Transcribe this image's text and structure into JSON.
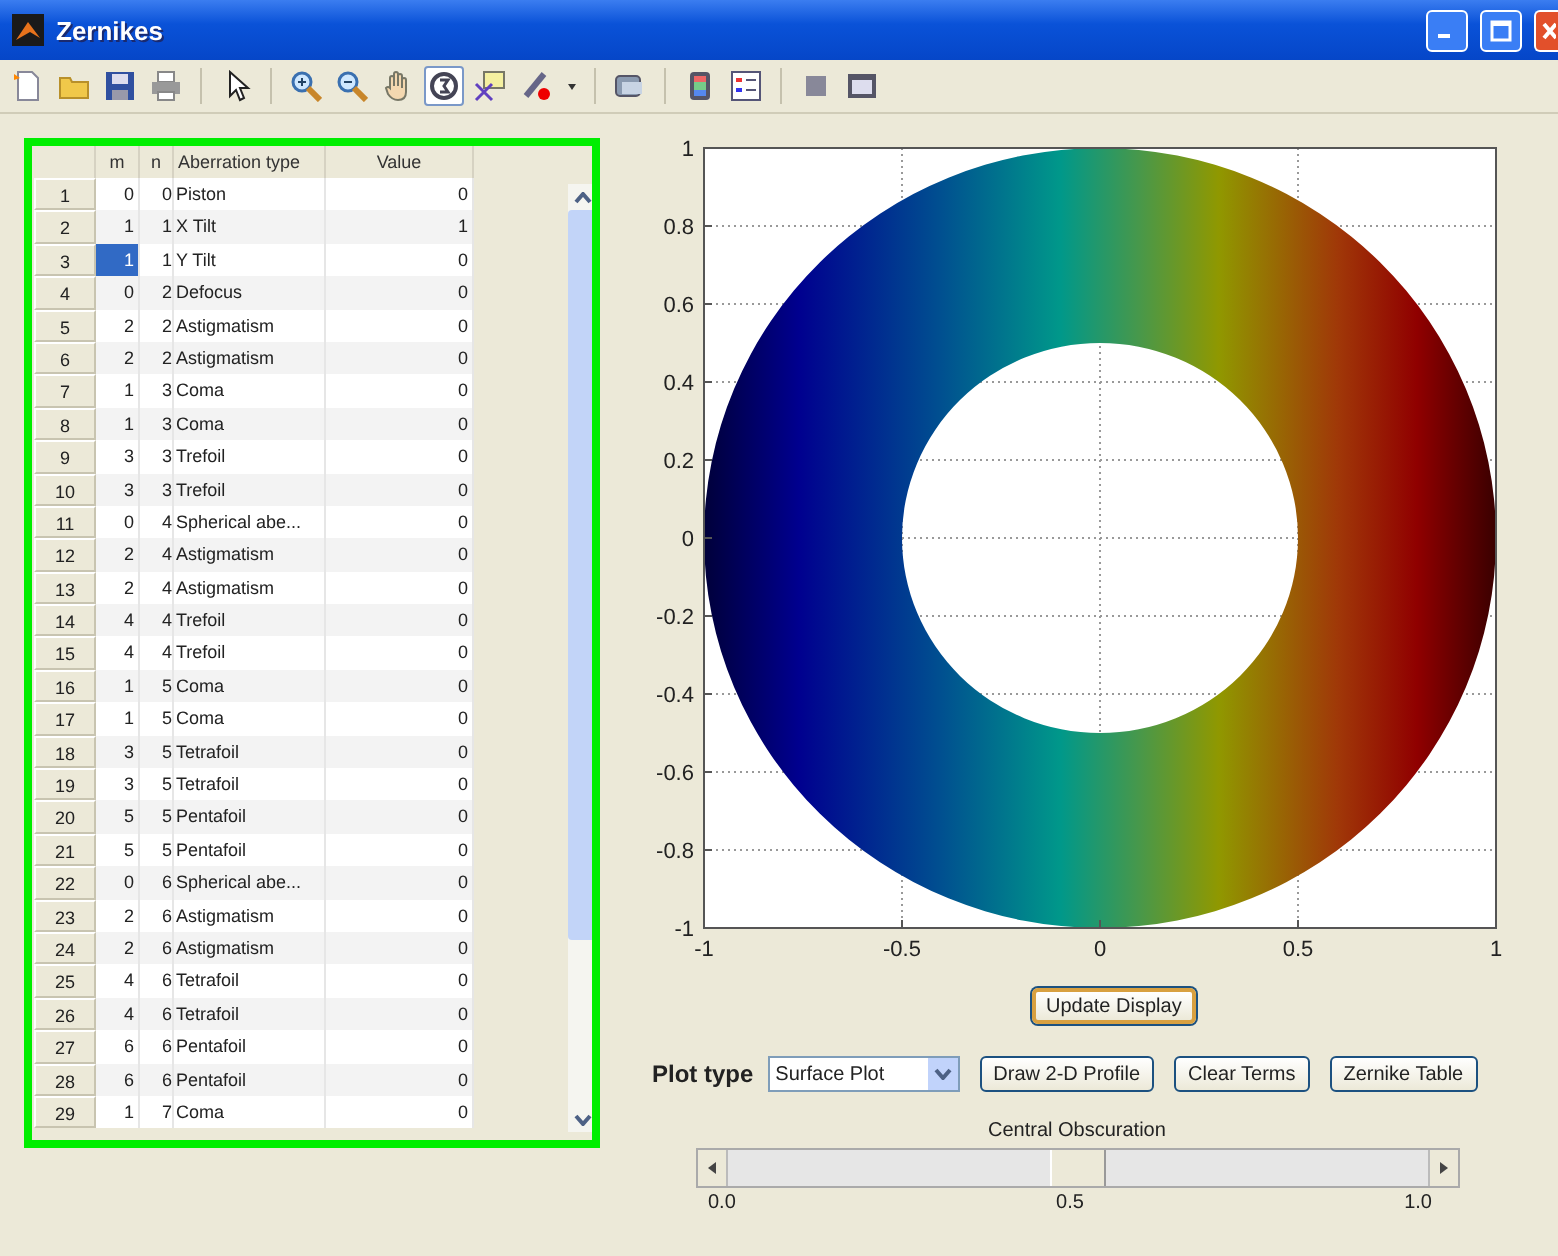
{
  "window": {
    "title": "Zernikes"
  },
  "toolbar": [
    {
      "kind": "new",
      "pressed": false
    },
    {
      "kind": "open",
      "pressed": false
    },
    {
      "kind": "save",
      "pressed": false
    },
    {
      "kind": "print",
      "pressed": false
    },
    {
      "kind": "sep"
    },
    {
      "kind": "pointer",
      "pressed": false
    },
    {
      "kind": "sep"
    },
    {
      "kind": "zoomin",
      "pressed": false
    },
    {
      "kind": "zoomout",
      "pressed": false
    },
    {
      "kind": "pan",
      "pressed": false
    },
    {
      "kind": "rotate",
      "pressed": true
    },
    {
      "kind": "cursor",
      "pressed": false
    },
    {
      "kind": "brush",
      "pressed": false
    },
    {
      "kind": "dropdown",
      "pressed": false
    },
    {
      "kind": "sep"
    },
    {
      "kind": "link",
      "pressed": false
    },
    {
      "kind": "sep"
    },
    {
      "kind": "colorbar",
      "pressed": false
    },
    {
      "kind": "legend",
      "pressed": false
    },
    {
      "kind": "sep"
    },
    {
      "kind": "hide",
      "pressed": false
    },
    {
      "kind": "show",
      "pressed": false
    }
  ],
  "table": {
    "columns": [
      "m",
      "n",
      "Aberration type",
      "Value"
    ],
    "rows": [
      {
        "index": "1",
        "m": "0",
        "n": "0",
        "type": "Piston",
        "value": "0",
        "m_selected": false
      },
      {
        "index": "2",
        "m": "1",
        "n": "1",
        "type": "X Tilt",
        "value": "1",
        "m_selected": false
      },
      {
        "index": "3",
        "m": "1",
        "n": "1",
        "type": "Y Tilt",
        "value": "0",
        "m_selected": true
      },
      {
        "index": "4",
        "m": "0",
        "n": "2",
        "type": "Defocus",
        "value": "0",
        "m_selected": false
      },
      {
        "index": "5",
        "m": "2",
        "n": "2",
        "type": "Astigmatism",
        "value": "0",
        "m_selected": false
      },
      {
        "index": "6",
        "m": "2",
        "n": "2",
        "type": "Astigmatism",
        "value": "0",
        "m_selected": false
      },
      {
        "index": "7",
        "m": "1",
        "n": "3",
        "type": "Coma",
        "value": "0",
        "m_selected": false
      },
      {
        "index": "8",
        "m": "1",
        "n": "3",
        "type": "Coma",
        "value": "0",
        "m_selected": false
      },
      {
        "index": "9",
        "m": "3",
        "n": "3",
        "type": "Trefoil",
        "value": "0",
        "m_selected": false
      },
      {
        "index": "10",
        "m": "3",
        "n": "3",
        "type": "Trefoil",
        "value": "0",
        "m_selected": false
      },
      {
        "index": "11",
        "m": "0",
        "n": "4",
        "type": "Spherical abe...",
        "value": "0",
        "m_selected": false
      },
      {
        "index": "12",
        "m": "2",
        "n": "4",
        "type": "Astigmatism",
        "value": "0",
        "m_selected": false
      },
      {
        "index": "13",
        "m": "2",
        "n": "4",
        "type": "Astigmatism",
        "value": "0",
        "m_selected": false
      },
      {
        "index": "14",
        "m": "4",
        "n": "4",
        "type": "Trefoil",
        "value": "0",
        "m_selected": false
      },
      {
        "index": "15",
        "m": "4",
        "n": "4",
        "type": "Trefoil",
        "value": "0",
        "m_selected": false
      },
      {
        "index": "16",
        "m": "1",
        "n": "5",
        "type": "Coma",
        "value": "0",
        "m_selected": false
      },
      {
        "index": "17",
        "m": "1",
        "n": "5",
        "type": "Coma",
        "value": "0",
        "m_selected": false
      },
      {
        "index": "18",
        "m": "3",
        "n": "5",
        "type": "Tetrafoil",
        "value": "0",
        "m_selected": false
      },
      {
        "index": "19",
        "m": "3",
        "n": "5",
        "type": "Tetrafoil",
        "value": "0",
        "m_selected": false
      },
      {
        "index": "20",
        "m": "5",
        "n": "5",
        "type": "Pentafoil",
        "value": "0",
        "m_selected": false
      },
      {
        "index": "21",
        "m": "5",
        "n": "5",
        "type": "Pentafoil",
        "value": "0",
        "m_selected": false
      },
      {
        "index": "22",
        "m": "0",
        "n": "6",
        "type": "Spherical abe...",
        "value": "0",
        "m_selected": false
      },
      {
        "index": "23",
        "m": "2",
        "n": "6",
        "type": "Astigmatism",
        "value": "0",
        "m_selected": false
      },
      {
        "index": "24",
        "m": "2",
        "n": "6",
        "type": "Astigmatism",
        "value": "0",
        "m_selected": false
      },
      {
        "index": "25",
        "m": "4",
        "n": "6",
        "type": "Tetrafoil",
        "value": "0",
        "m_selected": false
      },
      {
        "index": "26",
        "m": "4",
        "n": "6",
        "type": "Tetrafoil",
        "value": "0",
        "m_selected": false
      },
      {
        "index": "27",
        "m": "6",
        "n": "6",
        "type": "Pentafoil",
        "value": "0",
        "m_selected": false
      },
      {
        "index": "28",
        "m": "6",
        "n": "6",
        "type": "Pentafoil",
        "value": "0",
        "m_selected": false
      },
      {
        "index": "29",
        "m": "1",
        "n": "7",
        "type": "Coma",
        "value": "0",
        "m_selected": false
      }
    ]
  },
  "plot": {
    "x_tick_labels": [
      "-1",
      "-0.5",
      "0",
      "0.5",
      "1"
    ],
    "y_tick_labels": [
      "1",
      "0.8",
      "0.6",
      "0.4",
      "0.2",
      "0",
      "-0.2",
      "-0.4",
      "-0.6",
      "-0.8",
      "-1"
    ]
  },
  "update_button": "Update Display",
  "plot_type": {
    "label": "Plot type",
    "value": "Surface Plot"
  },
  "buttons": [
    "Draw 2-D Profile",
    "Clear Terms",
    "Zernike Table"
  ],
  "obscuration": {
    "label": "Central Obscuration",
    "level": 0.5,
    "tick_labels": [
      "0.0",
      "0.5",
      "1.0"
    ]
  }
}
